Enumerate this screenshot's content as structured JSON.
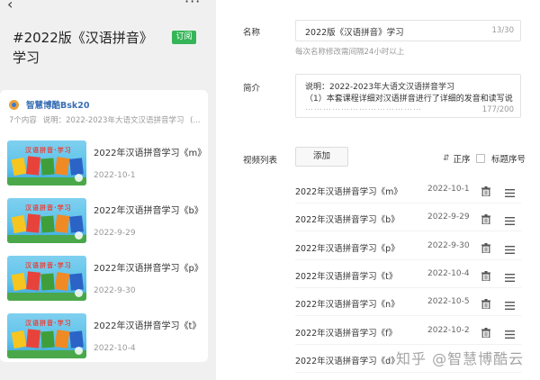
{
  "preview": {
    "back_glyph": "‹",
    "more_glyph": "···",
    "course_title": "#2022版《汉语拼音》学习",
    "subscribe_label": "订阅",
    "author": "智慧博酷Bsk20",
    "meta_count": "7个内容",
    "meta_desc": "说明：2022-2023年大语文汉语拼音学习",
    "meta_more": "(...",
    "thumb_text": "汉语拼音·学习",
    "lessons": [
      {
        "title": "2022年汉语拼音学习《m》",
        "date": "2022-10-1"
      },
      {
        "title": "2022年汉语拼音学习《b》",
        "date": "2022-9-29"
      },
      {
        "title": "2022年汉语拼音学习《p》",
        "date": "2022-9-30"
      },
      {
        "title": "2022年汉语拼音学习《t》",
        "date": "2022-10-4"
      }
    ]
  },
  "form": {
    "name_label": "名称",
    "name_value": "2022版《汉语拼音》学习",
    "name_count": "13/30",
    "name_hint": "每次名称修改需间隔24小时以上",
    "desc_label": "简介",
    "desc_line1": "说明：2022-2023年大语文汉语拼音学习",
    "desc_line2": "（1）本套课程详细对汉语拼音进行了详细的发音和读写说",
    "desc_line3": "…………………………………",
    "desc_count": "177/200",
    "list_label": "视频列表",
    "add_label": "添加",
    "sort_icon": "⇵",
    "sort_label": "正序",
    "seq_label": "标题序号",
    "videos": [
      {
        "title": "2022年汉语拼音学习《m》",
        "date": "2022-10-1"
      },
      {
        "title": "2022年汉语拼音学习《b》",
        "date": "2022-9-29"
      },
      {
        "title": "2022年汉语拼音学习《p》",
        "date": "2022-9-30"
      },
      {
        "title": "2022年汉语拼音学习《t》",
        "date": "2022-10-4"
      },
      {
        "title": "2022年汉语拼音学习《n》",
        "date": "2022-10-5"
      },
      {
        "title": "2022年汉语拼音学习《f》",
        "date": "2022-10-2"
      },
      {
        "title": "2022年汉语拼音学习《d》",
        "date": ""
      }
    ]
  },
  "watermark": "知乎 @智慧博酷云",
  "colors": {
    "accent_green": "#35b558",
    "author_blue": "#3a6fb5",
    "panel_gray": "#f0f0f0"
  }
}
